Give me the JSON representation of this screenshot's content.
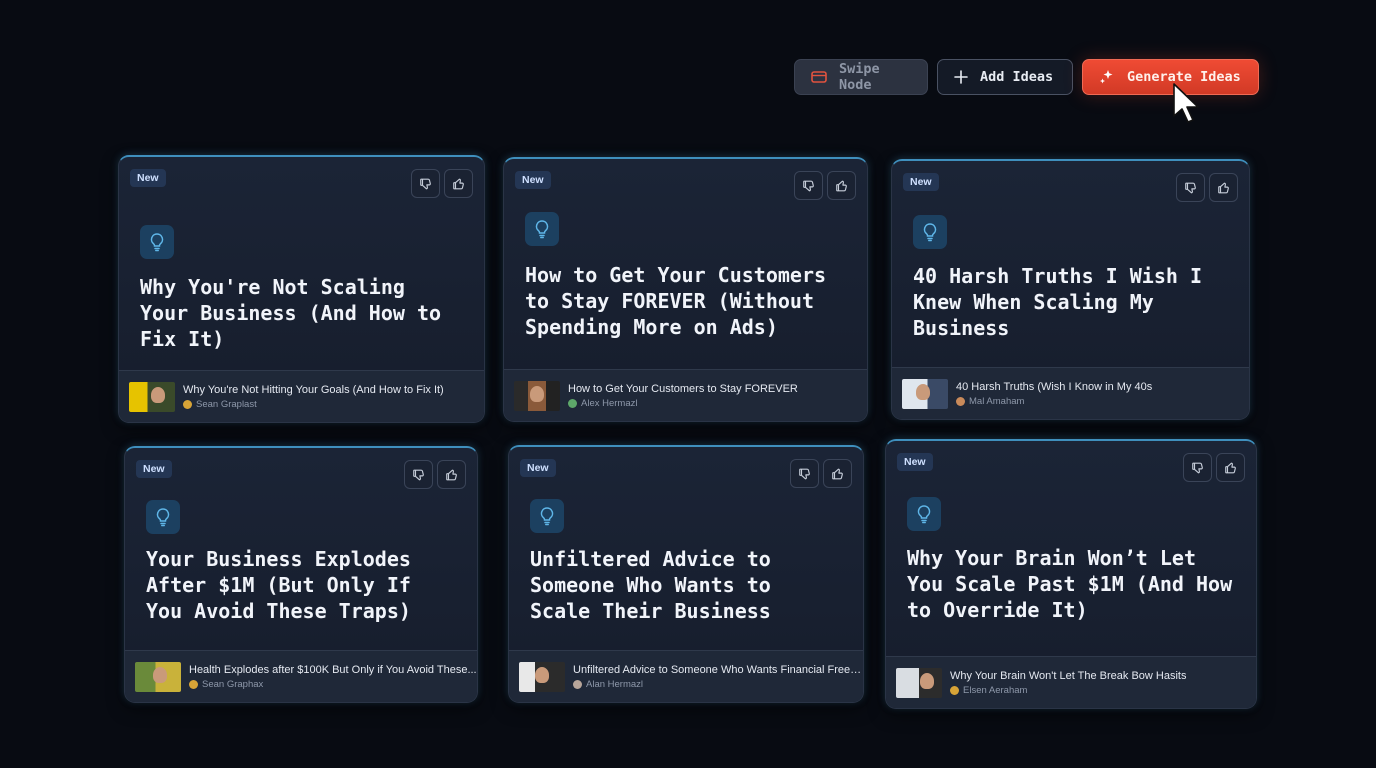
{
  "toolbar": {
    "swipe_label": "Swipe Node",
    "add_label": "Add Ideas",
    "generate_label": "Generate Ideas"
  },
  "colors": {
    "accent": "#e8432e",
    "card_border": "#3f8fbd",
    "background": "#080b12"
  },
  "icons": [
    "swipe-card-icon",
    "plus-icon",
    "sparkle-icon",
    "thumbs-down-icon",
    "thumbs-up-icon",
    "lightbulb-icon"
  ],
  "cards": [
    {
      "badge": "New",
      "title": "Why You're Not Scaling Your Business (And How to Fix It)",
      "source_title": "Why You're Not Hitting Your Goals (And How to Fix It)",
      "source_author": "Sean Graplast"
    },
    {
      "badge": "New",
      "title": "How to Get Your Customers to Stay FOREVER (Without Spending More on Ads)",
      "source_title": "How to Get Your Customers to Stay FOREVER",
      "source_author": "Alex Hermazl"
    },
    {
      "badge": "New",
      "title": "40 Harsh Truths I Wish I Knew When Scaling My Business",
      "source_title": "40 Harsh Truths (Wish I Know in My 40s",
      "source_author": "Mal Amaham"
    },
    {
      "badge": "New",
      "title": "Your Business Explodes After $1M (But Only If You Avoid These Traps)",
      "source_title": "Health Explodes after $100K But Only if You Avoid These...",
      "source_author": "Sean Graphax"
    },
    {
      "badge": "New",
      "title": "Unfiltered Advice to Someone Who Wants to Scale Their Business",
      "source_title": "Unfiltered Advice to Someone Who Wants Financial Freedom",
      "source_author": "Alan Hermazl"
    },
    {
      "badge": "New",
      "title": "Why Your Brain Won’t Let You Scale Past $1M (And How to Override It)",
      "source_title": "Why Your Brain Won't Let The Break Bow Hasits",
      "source_author": "Elsen Aeraham"
    }
  ]
}
